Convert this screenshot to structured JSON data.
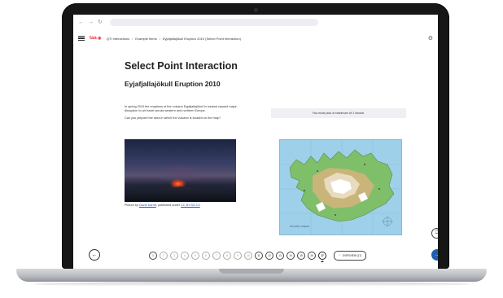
{
  "browser": {
    "back": "←",
    "forward": "→",
    "reload": "↻"
  },
  "header": {
    "logo": "taa",
    "breadcrumbs": [
      "QTI Interactions",
      "Example Items",
      "Eyjafjallajökull Eruption 2010 (Select Point Interaction)"
    ],
    "separator": "/"
  },
  "main": {
    "title": "Select Point Interaction",
    "subtitle": "Eyjafjallajökull Eruption 2010",
    "prompt_paragraph_1": "In spring 2010 the eruptions of the volcano Eyjafjallajökull in Iceland caused major disruption to air travel across western and northern Europe.",
    "prompt_paragraph_2": "Can you pinpoint the area in which the volcano is located on the map?",
    "caption_prefix": "Picture by ",
    "caption_author": "David Karnå",
    "caption_middle": ", published under ",
    "caption_license": "CC BY-SA 3.0",
    "notice": "You must pick a maximum of 1 choice."
  },
  "map": {
    "ocean_label": "ATLANTIC OCEAN"
  },
  "pagination": {
    "pages": [
      "1",
      "2",
      "3",
      "4",
      "5",
      "6",
      "7",
      "8",
      "9",
      "10",
      "11",
      "12",
      "13",
      "14",
      "15",
      "16",
      "17"
    ],
    "current": "17",
    "overview_label": "OVERVIEW (17)"
  },
  "colors": {
    "brand": "#e2393f",
    "next_button": "#1f5fb0",
    "link": "#1a56c8"
  },
  "icons": {
    "menu": "hamburger-icon",
    "settings": "gear-icon",
    "bookmark": "bookmark-icon",
    "prev": "arrow-left-icon",
    "next": "arrow-right-icon",
    "overview": "chevron-up-icon"
  }
}
